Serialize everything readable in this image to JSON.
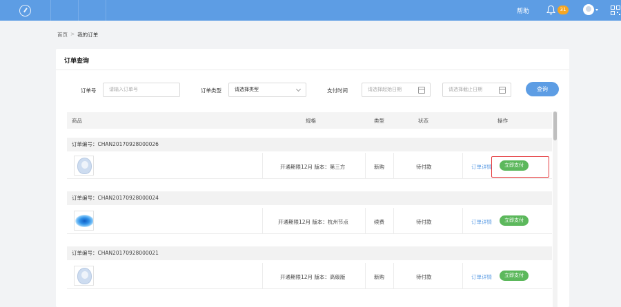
{
  "topbar": {
    "help_label": "帮助",
    "notification_count": "31",
    "colors": {
      "bar": "#5d9de4",
      "badge": "#f5a623"
    }
  },
  "breadcrumb": {
    "home": "首页",
    "separator": ">",
    "current": "我的订单"
  },
  "panel": {
    "title": "订单查询",
    "filters": {
      "order_no_label": "订单号",
      "order_no_placeholder": "请输入订单号",
      "order_type_label": "订单类型",
      "order_type_value": "请选择类型",
      "pay_time_label": "支付时间",
      "start_date_placeholder": "请选择起始日期",
      "end_date_placeholder": "请选择截止日期",
      "query_button": "查询"
    },
    "table": {
      "headers": {
        "product": "商品",
        "spec": "规格",
        "type": "类型",
        "status": "状态",
        "action": "操作"
      },
      "orders": [
        {
          "order_label": "订单编号：CHAN20170928000026",
          "thumb": "avatar-placeholder",
          "spec": "开通期限12月 版本：第三方",
          "type": "新购",
          "status": "待付款",
          "detail": "订单详情",
          "pay": "立即支付"
        },
        {
          "order_label": "订单编号：CHAN20170928000024",
          "thumb": "blue-disc",
          "spec": "开通期限12月 版本：杭州节点",
          "type": "续费",
          "status": "待付款",
          "detail": "订单详情",
          "pay": "立即支付"
        },
        {
          "order_label": "订单编号：CHAN20170928000021",
          "thumb": "avatar-placeholder",
          "spec": "开通期限12月 版本：高级版",
          "type": "新购",
          "status": "待付款",
          "detail": "订单详情",
          "pay": "立即支付"
        }
      ]
    }
  }
}
